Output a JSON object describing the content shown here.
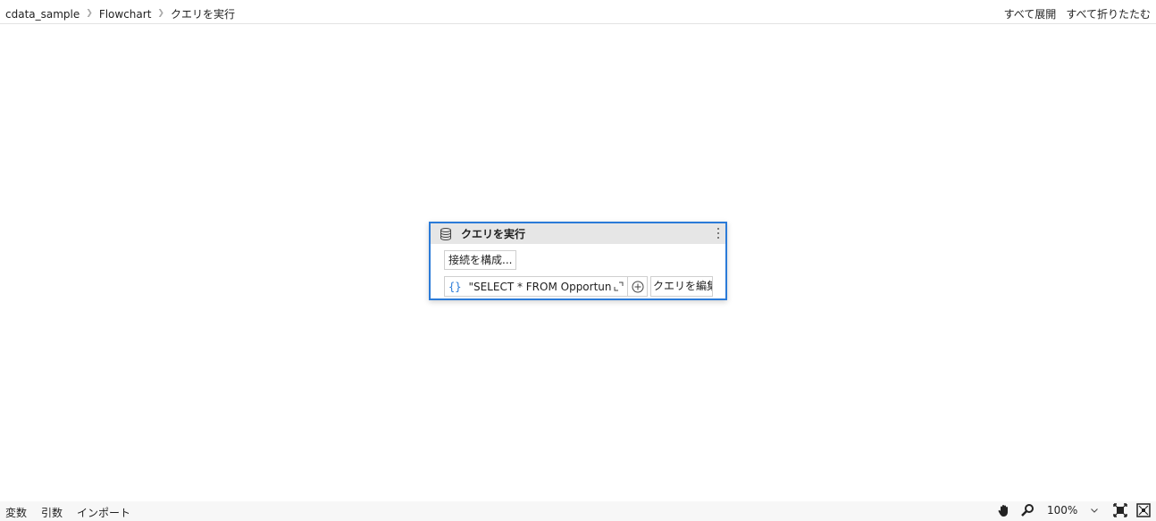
{
  "breadcrumb": {
    "items": [
      "cdata_sample",
      "Flowchart"
    ],
    "current": "クエリを実行",
    "separator_icon": "chevron-right-icon"
  },
  "top_actions": {
    "expand_all": "すべて展開",
    "collapse_all": "すべて折りたたむ"
  },
  "activity": {
    "title": "クエリを実行",
    "icon": "database-icon",
    "configure_connection": "接続を構成...",
    "query_value": "\"SELECT * FROM Opportunity",
    "edit_query": "クエリを編集...",
    "accent_color": "#2b7bd8"
  },
  "bottom_bar": {
    "tabs": [
      "変数",
      "引数",
      "インポート"
    ],
    "zoom": "100%"
  }
}
